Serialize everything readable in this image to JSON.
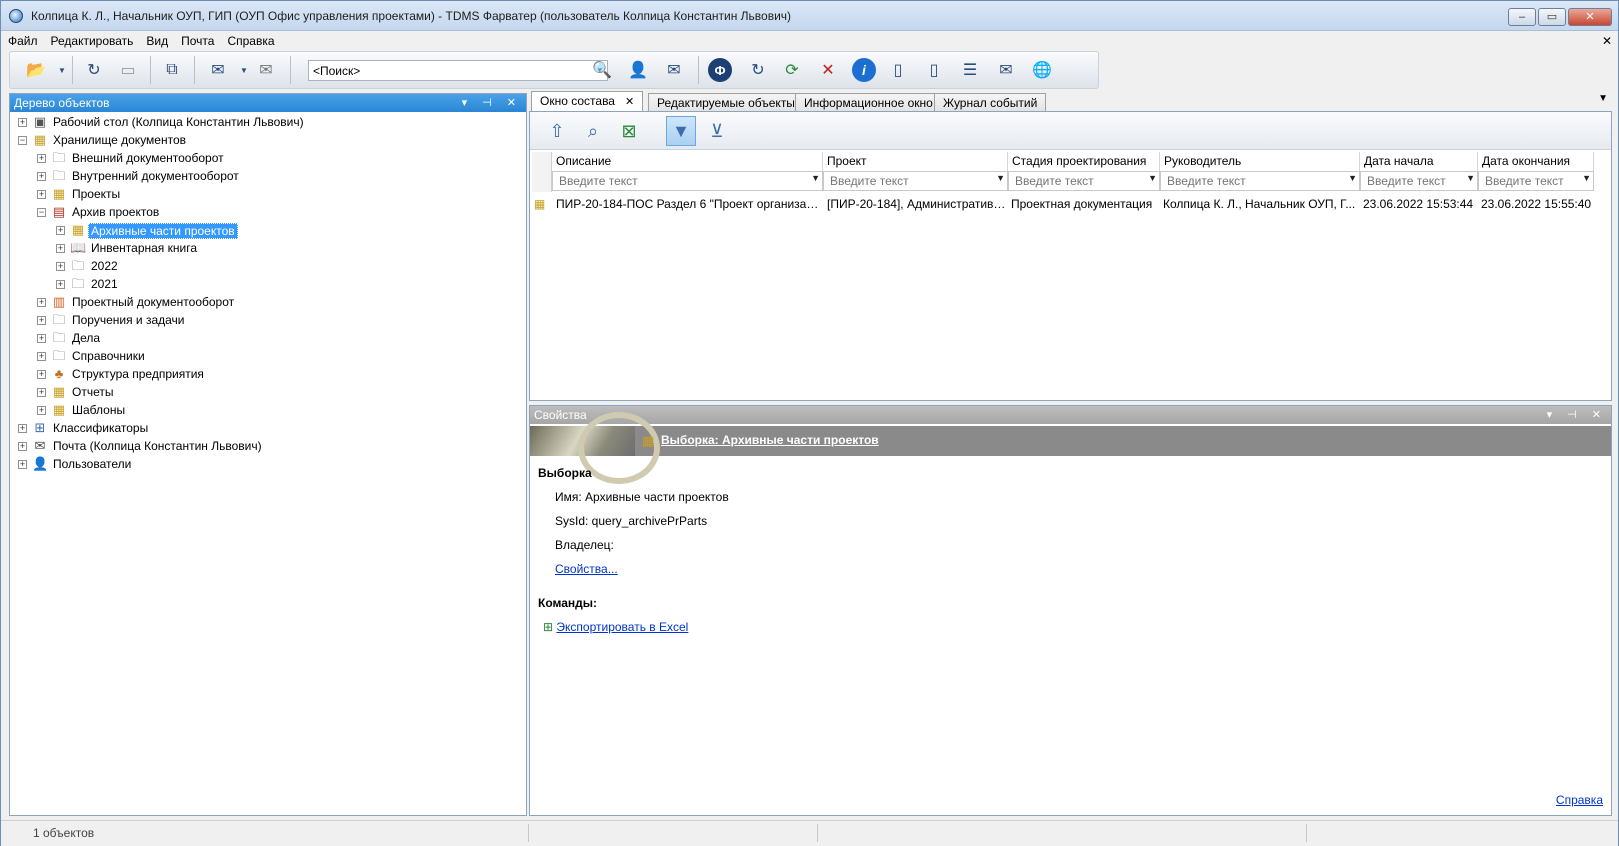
{
  "window": {
    "title": "Колпица К. Л., Начальник ОУП, ГИП (ОУП Офис управления проектами) - TDMS Фарватер (пользователь Колпица Константин Львович)",
    "btn_min": "‒",
    "btn_max": "▭",
    "btn_close": "✕"
  },
  "menu": {
    "items": [
      "Файл",
      "Редактировать",
      "Вид",
      "Почта",
      "Справка"
    ],
    "close": "✕"
  },
  "toolbar": {
    "search_value": "<Поиск>"
  },
  "tree_pane": {
    "title": "Дерево объектов",
    "controls": "▾ ⊣ ✕",
    "nodes": [
      {
        "label": "Рабочий стол (Колпица Константин Львович)",
        "icon": "desktop-icon"
      },
      {
        "label": "Хранилище документов",
        "icon": "storage-icon"
      },
      {
        "label": "Внешний документооборот",
        "icon": "folder-icon"
      },
      {
        "label": "Внутренний документооборот",
        "icon": "folder-icon"
      },
      {
        "label": "Проекты",
        "icon": "projects-icon"
      },
      {
        "label": "Архив проектов",
        "icon": "archive-icon"
      },
      {
        "label": "Архивные части проектов",
        "icon": "query-icon"
      },
      {
        "label": "Инвентарная книга",
        "icon": "book-icon"
      },
      {
        "label": "2022",
        "icon": "folder-icon"
      },
      {
        "label": "2021",
        "icon": "folder-icon"
      },
      {
        "label": "Проектный документооборот",
        "icon": "binders-icon"
      },
      {
        "label": "Поручения и задачи",
        "icon": "folder-icon"
      },
      {
        "label": "Дела",
        "icon": "folder-icon"
      },
      {
        "label": "Справочники",
        "icon": "folder-icon"
      },
      {
        "label": "Структура предприятия",
        "icon": "org-structure-icon"
      },
      {
        "label": "Отчеты",
        "icon": "reports-icon"
      },
      {
        "label": "Шаблоны",
        "icon": "templates-icon"
      },
      {
        "label": "Классификаторы",
        "icon": "classifier-icon"
      },
      {
        "label": "Почта (Колпица Константин Львович)",
        "icon": "mail-icon"
      },
      {
        "label": "Пользователи",
        "icon": "users-icon"
      }
    ]
  },
  "tabs": [
    {
      "label": "Окно состава"
    },
    {
      "label": "Редактируемые объекты"
    },
    {
      "label": "Информационное окно"
    },
    {
      "label": "Журнал событий"
    }
  ],
  "grid": {
    "columns": [
      "Описание",
      "Проект",
      "Стадия проектирования",
      "Руководитель",
      "Дата начала",
      "Дата окончания"
    ],
    "filter_placeholder": "Введите текст",
    "rows": [
      [
        "ПИР-20-184-ПОС Раздел 6 \"Проект организац...",
        "[ПИР-20-184], Административн...",
        "Проектная документация",
        "Колпица К. Л., Начальник ОУП, Г...",
        "23.06.2022 15:53:44",
        "23.06.2022 15:55:40"
      ]
    ]
  },
  "props_pane": {
    "title": "Свойства",
    "controls": "▾ ⊣ ✕",
    "banner_link": "Выборка: Архивные части проектов",
    "section1": "Выборка",
    "name_line": "Имя: Архивные части проектов",
    "sysid_line": "SysId: query_archivePrParts",
    "owner_line": "Владелец:",
    "props_link": "Свойства...",
    "section2": "Команды:",
    "export_link": "Экспортировать в Excel",
    "help_link": "Справка"
  },
  "status": {
    "count": "1 объектов"
  }
}
